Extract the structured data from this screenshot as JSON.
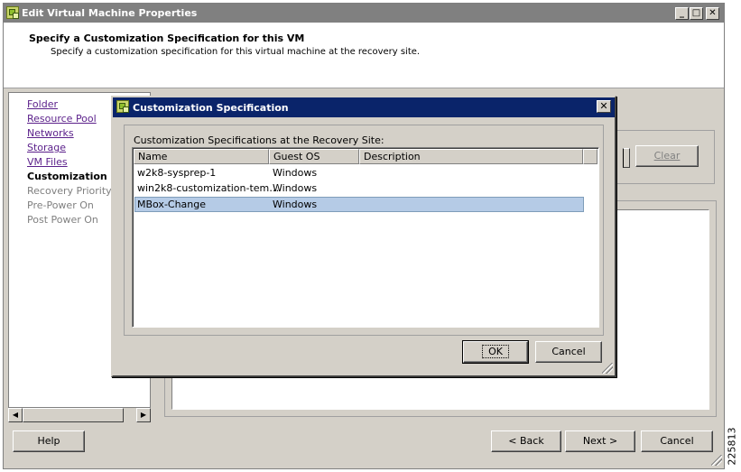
{
  "window": {
    "title": "Edit Virtual Machine Properties",
    "min_glyph": "_",
    "max_glyph": "□",
    "close_glyph": "✕"
  },
  "header": {
    "heading": "Specify a Customization Specification for this VM",
    "subheading": "Specify a customization specification for this virtual machine at the recovery site."
  },
  "nav": {
    "items": [
      {
        "label": "Folder",
        "style": "link"
      },
      {
        "label": "Resource Pool",
        "style": "link"
      },
      {
        "label": "Networks",
        "style": "link"
      },
      {
        "label": "Storage",
        "style": "link"
      },
      {
        "label": "VM Files",
        "style": "link"
      },
      {
        "label": "Customization Sp",
        "style": "current"
      },
      {
        "label": "Recovery Priority",
        "style": "disabled"
      },
      {
        "label": "Pre-Power On",
        "style": "disabled"
      },
      {
        "label": "Post Power On",
        "style": "disabled"
      }
    ]
  },
  "scrollbar": {
    "left_arrow": "◀",
    "right_arrow": "▶"
  },
  "panel": {
    "clear_label": "Clear"
  },
  "footer": {
    "help_label": "Help",
    "back_label": "< Back",
    "next_label": "Next >",
    "cancel_label": "Cancel"
  },
  "dialog": {
    "title": "Customization Specification",
    "close_glyph": "✕",
    "group_label": "Customization Specifications at the Recovery Site:",
    "columns": [
      "Name",
      "Guest OS",
      "Description"
    ],
    "rows": [
      {
        "name": "w2k8-sysprep-1",
        "guest_os": "Windows",
        "description": ""
      },
      {
        "name": "win2k8-customization-tem…",
        "guest_os": "Windows",
        "description": ""
      },
      {
        "name": "MBox-Change",
        "guest_os": "Windows",
        "description": "",
        "selected": true
      }
    ],
    "ok_label": "OK",
    "cancel_label": "Cancel"
  },
  "watermark": "225813",
  "colors": {
    "dialog_title_bg": "#0a246a",
    "selection_bg": "#b5cbe6",
    "link": "#5a1f8a"
  }
}
